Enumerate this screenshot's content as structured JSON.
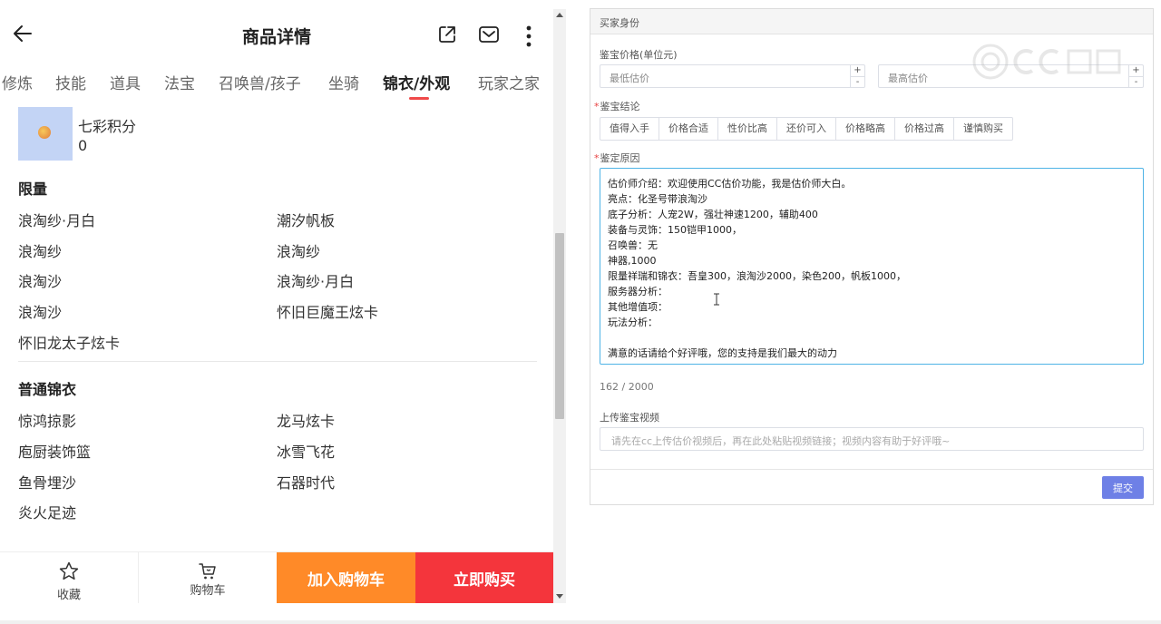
{
  "header": {
    "title": "商品详情"
  },
  "tabs": [
    "修炼",
    "技能",
    "道具",
    "法宝",
    "召唤兽/孩子",
    "坐骑",
    "锦衣/外观",
    "玩家之家"
  ],
  "active_tab": "锦衣/外观",
  "points": {
    "label": "七彩积分",
    "value": "0"
  },
  "limited": {
    "title": "限量",
    "items": [
      "浪淘纱·月白",
      "潮汐帆板",
      "浪淘纱",
      "浪淘纱",
      "浪淘沙",
      "浪淘纱·月白",
      "浪淘沙",
      "怀旧巨魔王炫卡",
      "怀旧龙太子炫卡"
    ]
  },
  "regular": {
    "title": "普通锦衣",
    "items": [
      "惊鸿掠影",
      "龙马炫卡",
      "庖厨装饰篮",
      "冰雪飞花",
      "鱼骨埋沙",
      "石器时代",
      "炎火足迹"
    ]
  },
  "bottom_bar": {
    "favorite": "收藏",
    "cart": "购物车",
    "add_cart": "加入购物车",
    "buy_now": "立即购买"
  },
  "form": {
    "panel_title": "买家身份",
    "price_label": "鉴宝价格(单位元)",
    "min_placeholder": "最低估价",
    "max_placeholder": "最高估价",
    "conclusion_label": "鉴宝结论",
    "conclusions": [
      "值得入手",
      "价格合适",
      "性价比高",
      "还价可入",
      "价格略高",
      "价格过高",
      "谨慎购买"
    ],
    "reason_label": "鉴定原因",
    "reason_lines": [
      "估价师介绍：欢迎使用CC估价功能，我是估价师大白。",
      "亮点：化圣号带浪淘沙",
      "底子分析：人宠2W，强壮神速1200，辅助400",
      "装备与灵饰：150铠甲1000，",
      "召唤兽：无",
      "神器,1000",
      "限量祥瑞和锦衣：吾皇300，浪淘沙2000，染色200，帆板1000，",
      "服务器分析：",
      "其他增值项：",
      "玩法分析：",
      "",
      "满意的话请给个好评哦，您的支持是我们最大的动力"
    ],
    "counter": "162 / 2000",
    "video_label": "上传鉴宝视频",
    "video_placeholder": "请先在cc上传估价视频后，再在此处粘贴视频链接；视频内容有助于好评哦~",
    "submit": "提交",
    "spin_plus": "+",
    "spin_minus": "-"
  },
  "colors": {
    "accent_red": "#f04a4a",
    "cart_orange": "#ff8a28",
    "buy_red": "#f4353c",
    "submit_blue": "#6e80e6",
    "focus_blue": "#4fb3e6"
  }
}
